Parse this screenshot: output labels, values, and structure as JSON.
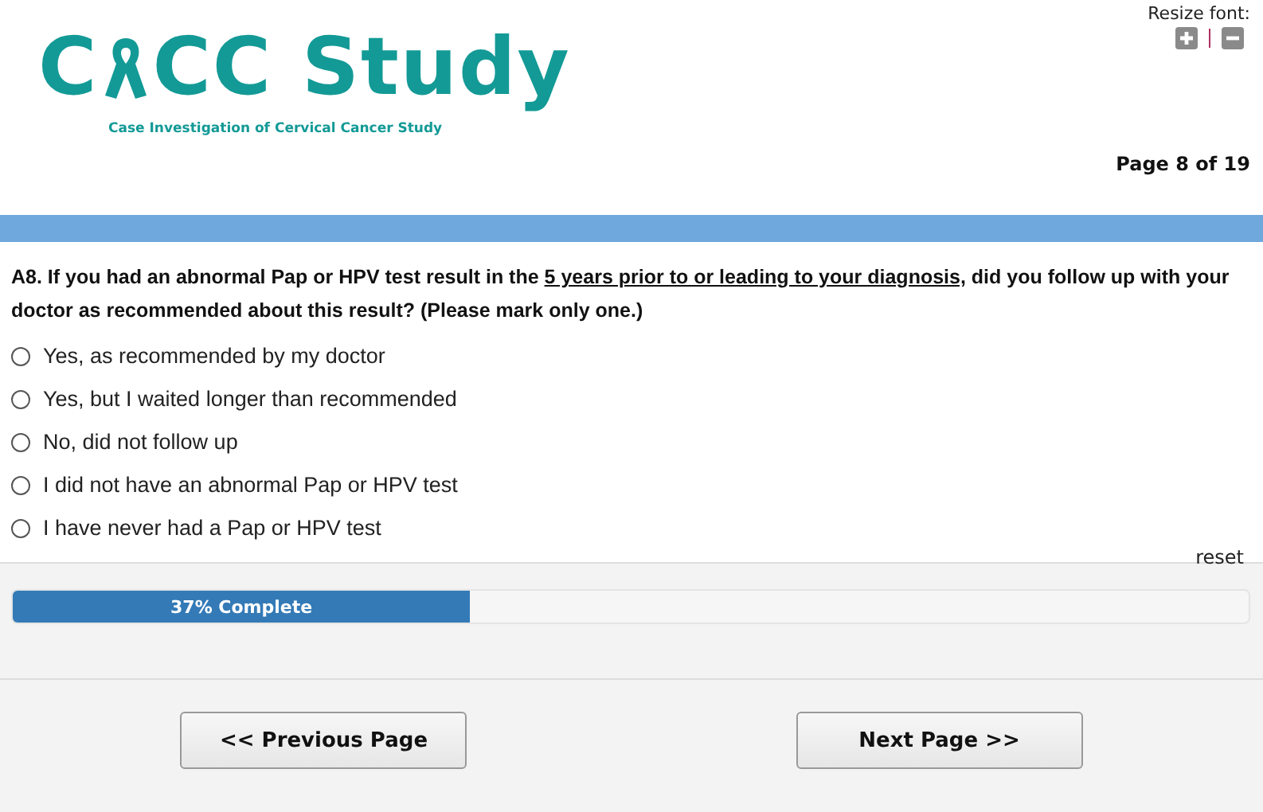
{
  "logo": {
    "before": "C",
    "after": "CC Study",
    "tagline": "Case Investigation of Cervical Cancer Study"
  },
  "resize_font": {
    "label": "Resize font:"
  },
  "page_indicator": "Page 8 of 19",
  "question": {
    "text_before": "A8. If you had an abnormal Pap or HPV test result in the",
    "text_underlined": "5 years prior to or leading to your diagnosis,",
    "text_after": "did you follow up with your doctor as recommended about this result? (Please mark only one.)",
    "options": [
      {
        "label": "Yes, as recommended by my doctor",
        "selected": false
      },
      {
        "label": "Yes, but I waited longer than recommended",
        "selected": false
      },
      {
        "label": "No, did not follow up",
        "selected": false
      },
      {
        "label": "I did not have an abnormal Pap or HPV test",
        "selected": false
      },
      {
        "label": "I have never had a Pap or HPV test",
        "selected": false
      }
    ],
    "reset": "reset"
  },
  "progress": {
    "level": 0.37,
    "label": "37% Complete"
  },
  "buttons": {
    "previous": "<< Previous Page",
    "next": "Next Page >>"
  }
}
